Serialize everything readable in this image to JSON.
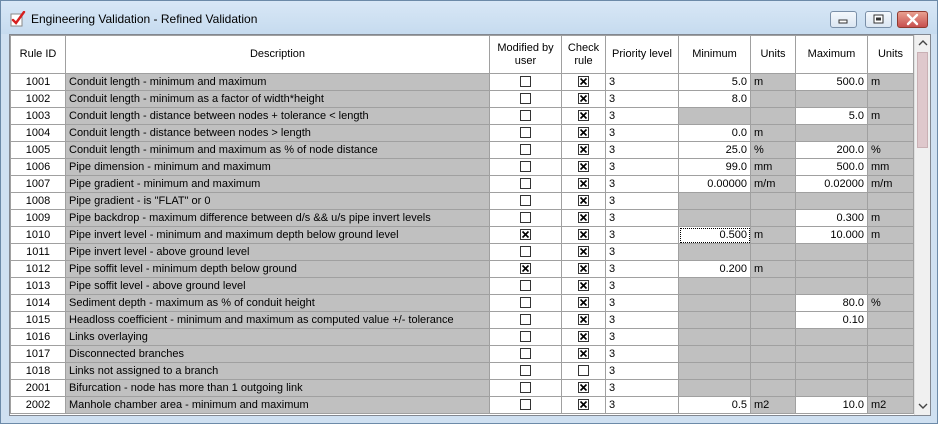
{
  "window": {
    "title": "Engineering Validation - Refined Validation",
    "app_icon": "validation-check-icon",
    "minimize_icon": "minimize-icon",
    "maximize_icon": "maximize-icon",
    "close_icon": "close-icon"
  },
  "headers": {
    "rule_id": "Rule ID",
    "description": "Description",
    "modified_line1": "Modified by",
    "modified_line2": "user",
    "check_line1": "Check",
    "check_line2": "rule",
    "priority": "Priority level",
    "minimum": "Minimum",
    "units_min": "Units",
    "maximum": "Maximum",
    "units_max": "Units"
  },
  "rows": [
    {
      "id": "1001",
      "desc": "Conduit length - minimum and maximum",
      "modified": false,
      "check": true,
      "priority": "3",
      "min": "5.0",
      "min_units": "m",
      "max": "500.0",
      "max_units": "m",
      "min_enabled": true,
      "max_enabled": true
    },
    {
      "id": "1002",
      "desc": "Conduit length - minimum as a factor of width*height",
      "modified": false,
      "check": true,
      "priority": "3",
      "min": "8.0",
      "min_units": "",
      "max": "",
      "max_units": "",
      "min_enabled": true,
      "max_enabled": false
    },
    {
      "id": "1003",
      "desc": "Conduit length - distance between nodes + tolerance < length",
      "modified": false,
      "check": true,
      "priority": "3",
      "min": "",
      "min_units": "",
      "max": "5.0",
      "max_units": "m",
      "min_enabled": false,
      "max_enabled": true
    },
    {
      "id": "1004",
      "desc": "Conduit length - distance between nodes > length",
      "modified": false,
      "check": true,
      "priority": "3",
      "min": "0.0",
      "min_units": "m",
      "max": "",
      "max_units": "",
      "min_enabled": true,
      "max_enabled": false
    },
    {
      "id": "1005",
      "desc": "Conduit length - minimum and maximum as % of node distance",
      "modified": false,
      "check": true,
      "priority": "3",
      "min": "25.0",
      "min_units": "%",
      "max": "200.0",
      "max_units": "%",
      "min_enabled": true,
      "max_enabled": true
    },
    {
      "id": "1006",
      "desc": "Pipe dimension - minimum and maximum",
      "modified": false,
      "check": true,
      "priority": "3",
      "min": "99.0",
      "min_units": "mm",
      "max": "500.0",
      "max_units": "mm",
      "min_enabled": true,
      "max_enabled": true
    },
    {
      "id": "1007",
      "desc": "Pipe gradient - minimum and maximum",
      "modified": false,
      "check": true,
      "priority": "3",
      "min": "0.00000",
      "min_units": "m/m",
      "max": "0.02000",
      "max_units": "m/m",
      "min_enabled": true,
      "max_enabled": true
    },
    {
      "id": "1008",
      "desc": "Pipe gradient - is \"FLAT\" or 0",
      "modified": false,
      "check": true,
      "priority": "3",
      "min": "",
      "min_units": "",
      "max": "",
      "max_units": "",
      "min_enabled": false,
      "max_enabled": false
    },
    {
      "id": "1009",
      "desc": "Pipe backdrop - maximum difference between d/s && u/s pipe invert levels",
      "modified": false,
      "check": true,
      "priority": "3",
      "min": "",
      "min_units": "",
      "max": "0.300",
      "max_units": "m",
      "min_enabled": false,
      "max_enabled": true
    },
    {
      "id": "1010",
      "desc": "Pipe invert level - minimum and maximum depth below ground level",
      "modified": true,
      "check": true,
      "priority": "3",
      "min": "0.500",
      "min_units": "m",
      "max": "10.000",
      "max_units": "m",
      "min_enabled": true,
      "max_enabled": true,
      "focus": true
    },
    {
      "id": "1011",
      "desc": "Pipe invert level - above ground level",
      "modified": false,
      "check": true,
      "priority": "3",
      "min": "",
      "min_units": "",
      "max": "",
      "max_units": "",
      "min_enabled": false,
      "max_enabled": false
    },
    {
      "id": "1012",
      "desc": "Pipe soffit level - minimum depth below ground",
      "modified": true,
      "check": true,
      "priority": "3",
      "min": "0.200",
      "min_units": "m",
      "max": "",
      "max_units": "",
      "min_enabled": true,
      "max_enabled": false
    },
    {
      "id": "1013",
      "desc": "Pipe soffit level - above ground level",
      "modified": false,
      "check": true,
      "priority": "3",
      "min": "",
      "min_units": "",
      "max": "",
      "max_units": "",
      "min_enabled": false,
      "max_enabled": false
    },
    {
      "id": "1014",
      "desc": "Sediment depth - maximum as % of conduit height",
      "modified": false,
      "check": true,
      "priority": "3",
      "min": "",
      "min_units": "",
      "max": "80.0",
      "max_units": "%",
      "min_enabled": false,
      "max_enabled": true
    },
    {
      "id": "1015",
      "desc": "Headloss coefficient - minimum and maximum as computed value +/- tolerance",
      "modified": false,
      "check": true,
      "priority": "3",
      "min": "",
      "min_units": "",
      "max": "0.10",
      "max_units": "",
      "min_enabled": false,
      "max_enabled": true
    },
    {
      "id": "1016",
      "desc": "Links overlaying",
      "modified": false,
      "check": true,
      "priority": "3",
      "min": "",
      "min_units": "",
      "max": "",
      "max_units": "",
      "min_enabled": false,
      "max_enabled": false
    },
    {
      "id": "1017",
      "desc": "Disconnected branches",
      "modified": false,
      "check": true,
      "priority": "3",
      "min": "",
      "min_units": "",
      "max": "",
      "max_units": "",
      "min_enabled": false,
      "max_enabled": false
    },
    {
      "id": "1018",
      "desc": "Links not assigned to a branch",
      "modified": false,
      "check": false,
      "priority": "3",
      "min": "",
      "min_units": "",
      "max": "",
      "max_units": "",
      "min_enabled": false,
      "max_enabled": false
    },
    {
      "id": "2001",
      "desc": "Bifurcation - node has more than 1 outgoing link",
      "modified": false,
      "check": true,
      "priority": "3",
      "min": "",
      "min_units": "",
      "max": "",
      "max_units": "",
      "min_enabled": false,
      "max_enabled": false
    },
    {
      "id": "2002",
      "desc": "Manhole chamber area - minimum and maximum",
      "modified": false,
      "check": true,
      "priority": "3",
      "min": "0.5",
      "min_units": "m2",
      "max": "10.0",
      "max_units": "m2",
      "min_enabled": true,
      "max_enabled": true
    }
  ],
  "scrollbar": {
    "up_icon": "chevron-up-icon",
    "down_icon": "chevron-down-icon",
    "thumb_fraction": 0.26
  },
  "colors": {
    "disabled_cell": "#c0c0c0",
    "enabled_cell": "#ffffff",
    "close_button": "#c75050",
    "title_bar": "#cfe0f1"
  }
}
